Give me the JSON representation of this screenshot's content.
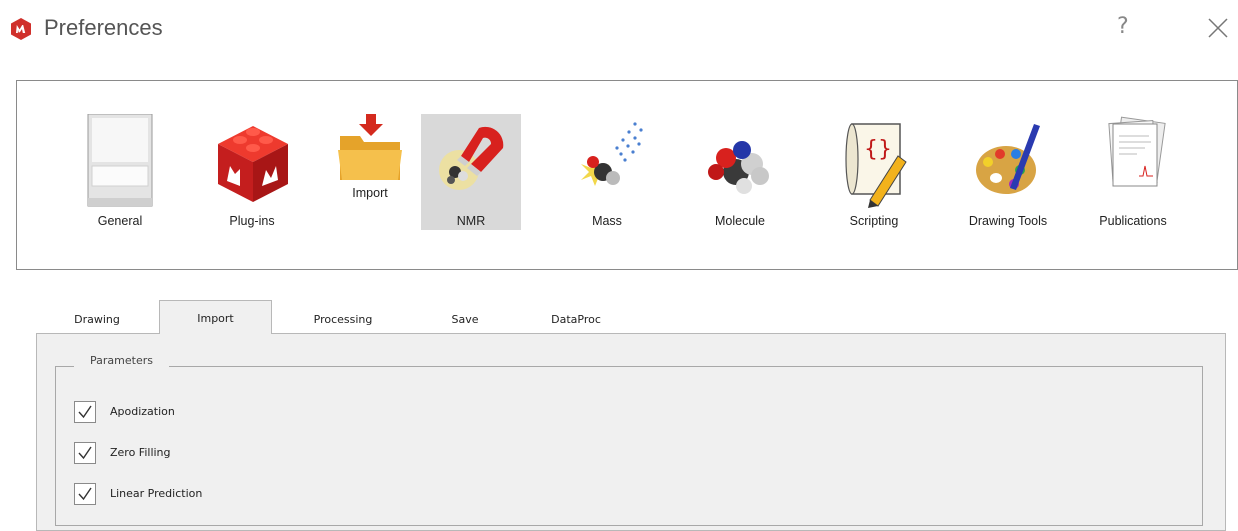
{
  "window": {
    "title": "Preferences",
    "help_symbol": "?",
    "close_icon": "close-icon",
    "app_icon": "mnova-logo-icon",
    "brand_color": "#d0302b"
  },
  "categories": [
    {
      "label": "General",
      "icon": "general-icon",
      "selected": false
    },
    {
      "label": "Plug-ins",
      "icon": "plugins-brick-icon",
      "selected": false
    },
    {
      "label": "Import",
      "icon": "import-folder-icon",
      "selected": false
    },
    {
      "label": "NMR",
      "icon": "nmr-magnet-icon",
      "selected": true
    },
    {
      "label": "Mass",
      "icon": "mass-spec-icon",
      "selected": false
    },
    {
      "label": "Molecule",
      "icon": "molecule-icon",
      "selected": false
    },
    {
      "label": "Scripting",
      "icon": "scripting-scroll-icon",
      "selected": false
    },
    {
      "label": "Drawing Tools",
      "icon": "palette-icon",
      "selected": false
    },
    {
      "label": "Publications",
      "icon": "publications-icon",
      "selected": false
    }
  ],
  "tabs": [
    {
      "label": "Drawing",
      "active": false
    },
    {
      "label": "Import",
      "active": true
    },
    {
      "label": "Processing",
      "active": false
    },
    {
      "label": "Save",
      "active": false
    },
    {
      "label": "DataProc",
      "active": false
    }
  ],
  "parameters": {
    "title": "Parameters",
    "items": [
      {
        "label": "Apodization",
        "checked": true
      },
      {
        "label": "Zero Filling",
        "checked": true
      },
      {
        "label": "Linear Prediction",
        "checked": true
      }
    ]
  }
}
